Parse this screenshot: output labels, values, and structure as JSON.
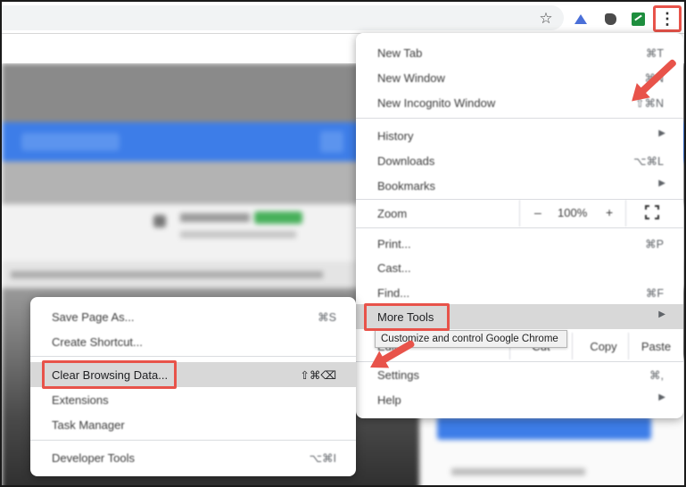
{
  "colors": {
    "annotation": "#e8534a",
    "page_blue": "#3d7de8",
    "highlight": "#d8d8d8"
  },
  "toolbar": {
    "icons": [
      "star-icon",
      "extension-triangle-icon",
      "extension-puzzle-icon",
      "extension-sheets-icon",
      "kebab-menu-icon"
    ],
    "menu_glyph": "⋮",
    "star_glyph": "☆"
  },
  "chrome_menu": {
    "items": [
      {
        "label": "New Tab",
        "shortcut": "⌘T"
      },
      {
        "label": "New Window",
        "shortcut": "⌘N"
      },
      {
        "label": "New Incognito Window",
        "shortcut": "⇧⌘N"
      },
      {
        "label": "History",
        "arrow": "▶"
      },
      {
        "label": "Downloads",
        "shortcut": "⌥⌘L"
      },
      {
        "label": "Bookmarks",
        "arrow": "▶"
      }
    ],
    "zoom": {
      "label": "Zoom",
      "minus": "–",
      "value": "100%",
      "plus": "+"
    },
    "items2": [
      {
        "label": "Print...",
        "shortcut": "⌘P"
      },
      {
        "label": "Cast..."
      },
      {
        "label": "Find...",
        "shortcut": "⌘F"
      },
      {
        "label": "More Tools",
        "arrow": "▶"
      }
    ],
    "edit": {
      "label": "Edit",
      "cut": "Cut",
      "copy": "Copy",
      "paste": "Paste"
    },
    "items3": [
      {
        "label": "Settings",
        "shortcut": "⌘,"
      },
      {
        "label": "Help",
        "arrow": "▶"
      }
    ],
    "tooltip": "Customize and control Google Chrome"
  },
  "more_tools_submenu": {
    "items": [
      {
        "label": "Save Page As...",
        "shortcut": "⌘S"
      },
      {
        "label": "Create Shortcut..."
      },
      {
        "label": "Clear Browsing Data...",
        "shortcut": "⇧⌘⌫"
      },
      {
        "label": "Extensions"
      },
      {
        "label": "Task Manager"
      },
      {
        "label": "Developer Tools",
        "shortcut": "⌥⌘I"
      }
    ]
  }
}
